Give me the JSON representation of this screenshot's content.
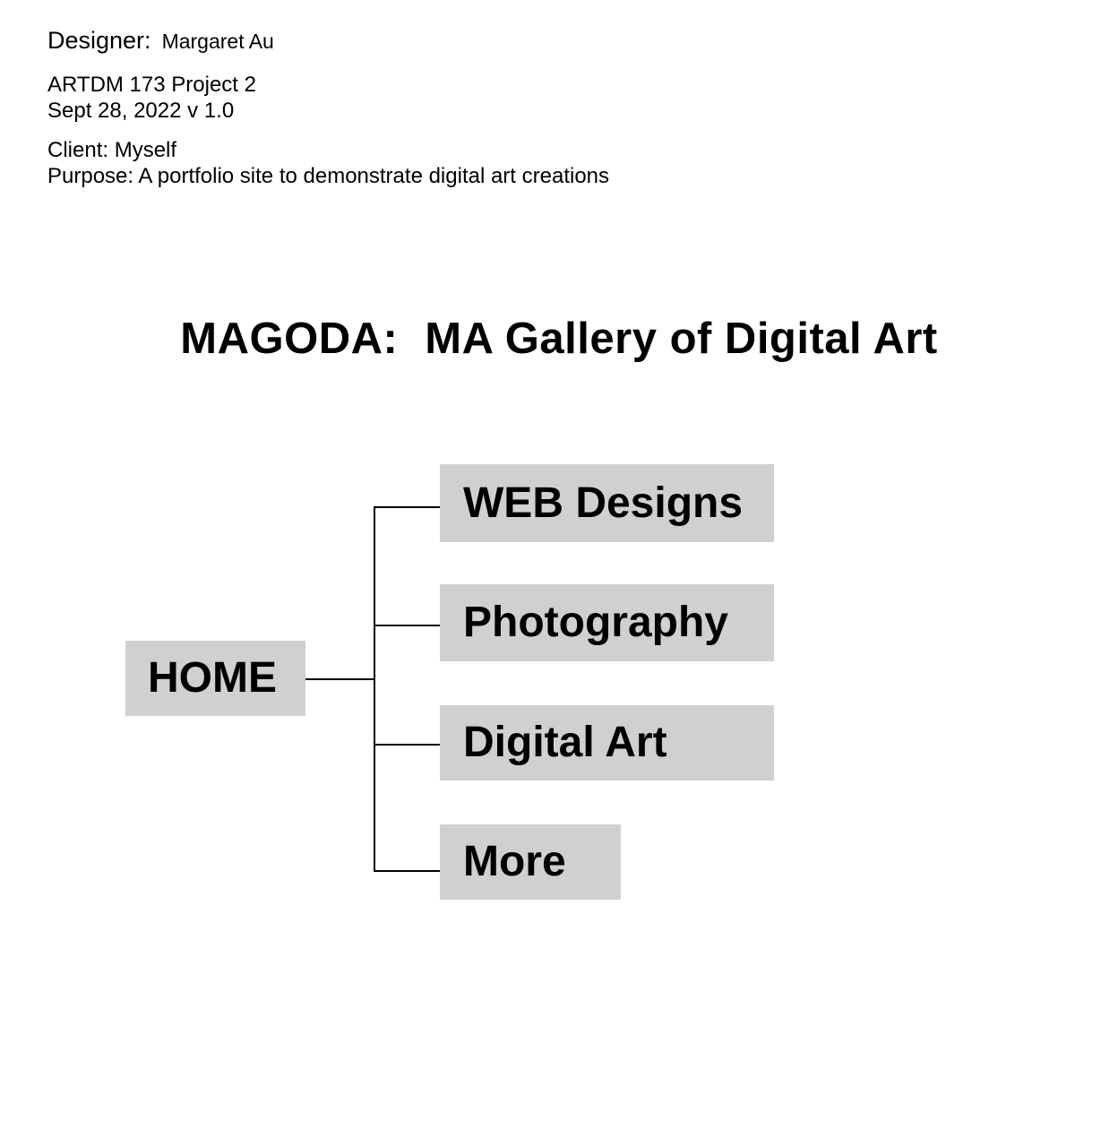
{
  "header": {
    "designer_label": "Designer:",
    "designer_name": "Margaret Au",
    "course": "ARTDM 173 Project 2",
    "date_version": "Sept 28, 2022 v 1.0",
    "client": "Client: Myself",
    "purpose": "Purpose: A portfolio site to demonstrate digital art creations"
  },
  "site": {
    "title_abbr": "MAGODA:",
    "title_full": "MA Gallery of Digital Art"
  },
  "sitemap": {
    "root": "HOME",
    "children": [
      "WEB Designs",
      "Photography",
      "Digital Art",
      "More"
    ]
  },
  "colors": {
    "node_fill": "#d0d0d0",
    "text": "#000000",
    "background": "#ffffff"
  }
}
